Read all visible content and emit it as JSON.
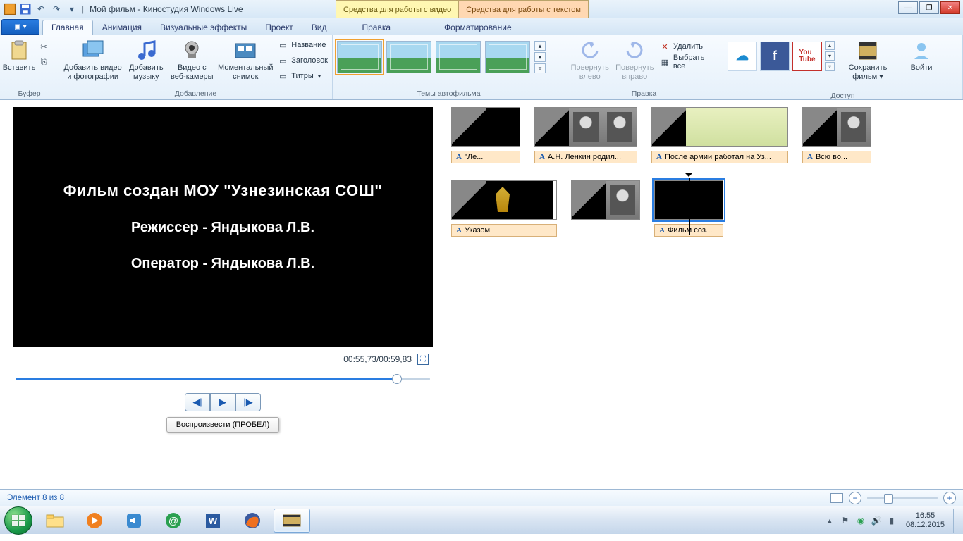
{
  "titlebar": {
    "app_title": "Мой фильм - Киностудия Windows Live",
    "ctx_video": "Средства для работы с видео",
    "ctx_text": "Средства для работы с текстом"
  },
  "ribbon_tabs": {
    "home": "Главная",
    "animation": "Анимация",
    "effects": "Визуальные эффекты",
    "project": "Проект",
    "view": "Вид",
    "edit_video": "Правка",
    "format_text": "Форматирование"
  },
  "ribbon": {
    "buffer": {
      "paste": "Вставить",
      "group": "Буфер"
    },
    "add": {
      "add_video": "Добавить видео и фотографии",
      "add_music": "Добавить музыку",
      "webcam": "Видео с веб-камеры",
      "snapshot": "Моментальный снимок",
      "title": "Название",
      "caption": "Заголовок",
      "credits": "Титры",
      "group": "Добавление"
    },
    "themes": {
      "group": "Темы автофильма"
    },
    "edit": {
      "rotate_left": "Повернуть влево",
      "rotate_right": "Повернуть вправо",
      "delete": "Удалить",
      "select_all": "Выбрать все",
      "group": "Правка"
    },
    "share": {
      "skydrive": "SkyDrive",
      "save_movie": "Сохранить фильм",
      "signin": "Войти",
      "group": "Доступ"
    }
  },
  "preview": {
    "line1": "Фильм создан МОУ \"Узнезинская СОШ\"",
    "line2": "Режиссер - Яндыкова Л.В.",
    "line3": "Оператор - Яндыкова Л.В.",
    "time": "00:55,73/00:59,83",
    "tooltip": "Воспроизвести (ПРОБЕЛ)"
  },
  "clips": {
    "c1": "\"Ле...",
    "c2": "А.Н. Ленкин родил...",
    "c3": "После армии работал на Уз...",
    "c4": "Всю во...",
    "c5": "Указом",
    "c6": "Фильм соз..."
  },
  "status": {
    "item": "Элемент 8 из 8"
  },
  "tray": {
    "time": "16:55",
    "date": "08.12.2015"
  }
}
